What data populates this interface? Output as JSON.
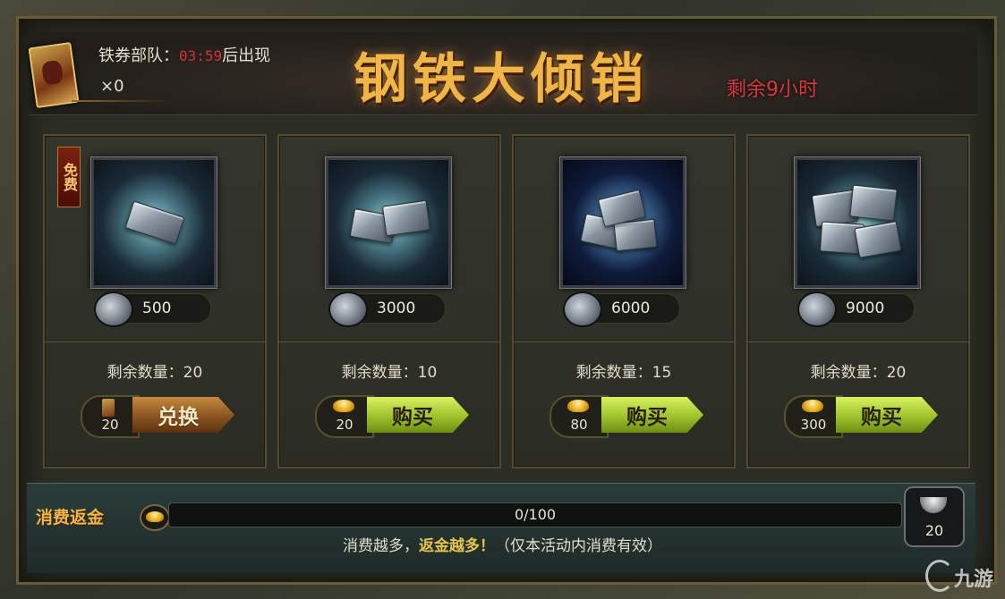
{
  "header": {
    "title": "钢铁大倾销",
    "remaining_time": "剩余9小时",
    "troop_label": "铁券部队：",
    "troop_timer": "03:59",
    "troop_suffix": "后出现",
    "troop_count": "×0"
  },
  "free_tag": "免费",
  "items": [
    {
      "price": "500",
      "stock_label": "剩余数量：20",
      "cost": "20",
      "button_label": "兑换",
      "currency": "card-icon"
    },
    {
      "price": "3000",
      "stock_label": "剩余数量：10",
      "cost": "20",
      "button_label": "购买",
      "currency": "gold-ingot-icon"
    },
    {
      "price": "6000",
      "stock_label": "剩余数量：15",
      "cost": "80",
      "button_label": "购买",
      "currency": "gold-ingot-icon"
    },
    {
      "price": "9000",
      "stock_label": "剩余数量：20",
      "cost": "300",
      "button_label": "购买",
      "currency": "gold-ingot-icon"
    }
  ],
  "footer": {
    "rebate_label": "消费返金",
    "progress_text": "0/100",
    "progress_value": 0,
    "hint_prefix": "消费越多，",
    "hint_highlight": "返金越多！",
    "hint_suffix": "（仅本活动内消费有效）",
    "reward_count": "20"
  },
  "watermark": "九游",
  "colors": {
    "title": "#f0b547",
    "timer": "#d4303a",
    "buy_button": "#9dc22a",
    "exchange_button": "#8b5321"
  }
}
